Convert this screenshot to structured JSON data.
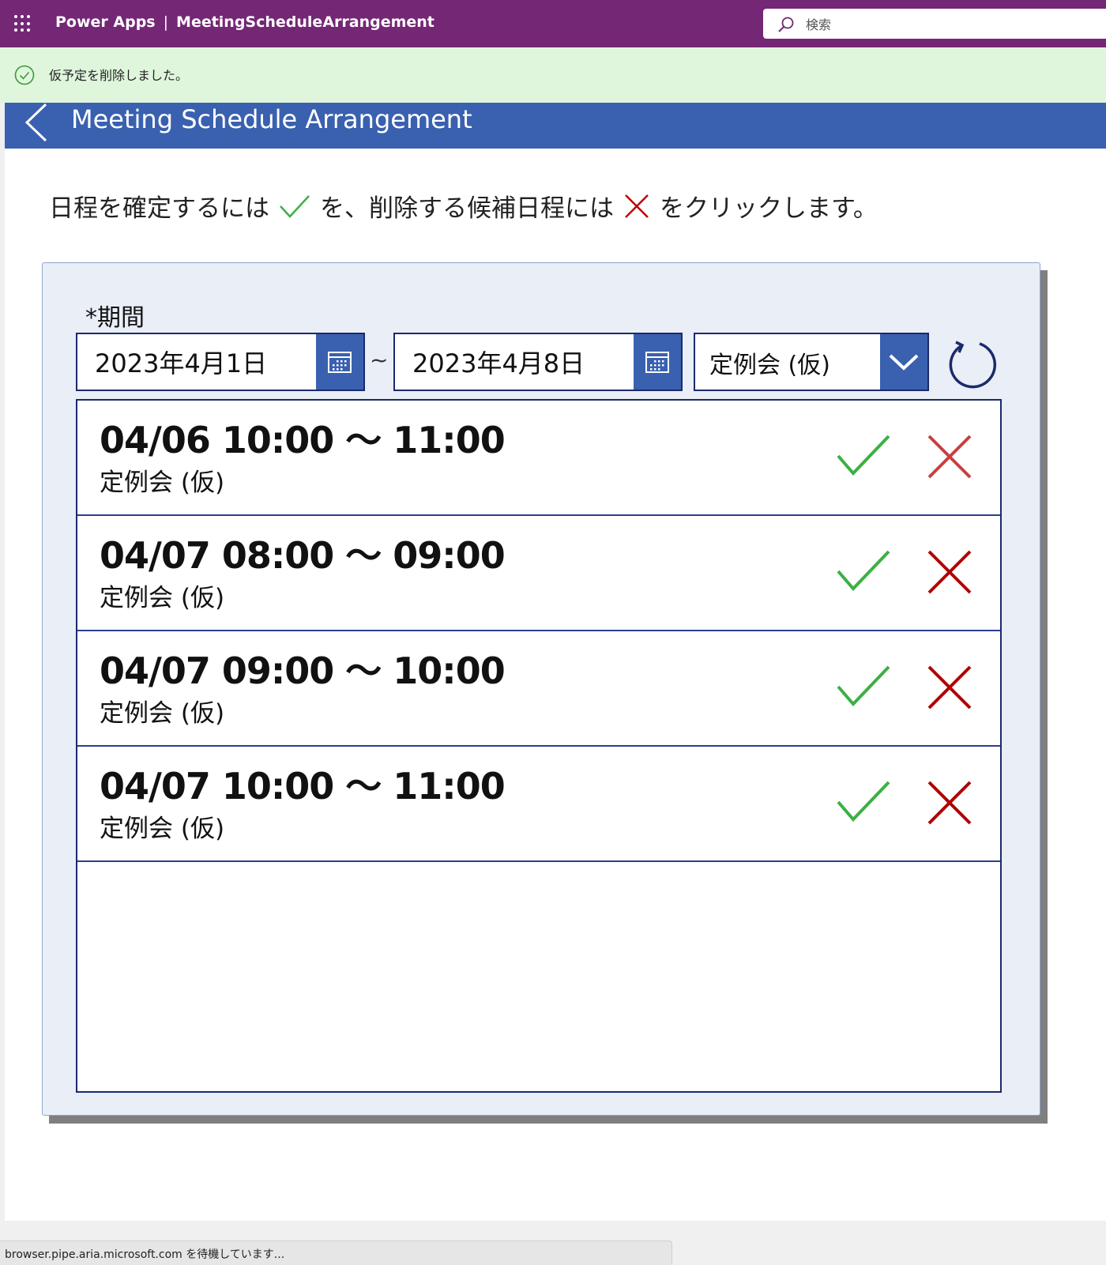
{
  "topbar": {
    "brand": "Power Apps",
    "separator": "|",
    "app_name": "MeetingScheduleArrangement",
    "search_placeholder": "検索",
    "background": "#742774"
  },
  "notification": {
    "message": "仮予定を削除しました。",
    "icon": "check-circle-icon",
    "background": "#dff6dd"
  },
  "header": {
    "title": "Meeting Schedule Arrangement",
    "back_icon": "chevron-left-icon",
    "background": "#3a60b0"
  },
  "instruction": {
    "part1": "日程を確定するには",
    "part2": "を、削除する候補日程には",
    "part3": "をクリックします。"
  },
  "filter": {
    "period_label": "*期間",
    "start_date": "2023年4月1日",
    "separator": "~",
    "end_date": "2023年4月8日",
    "category_selected": "定例会 (仮)"
  },
  "meetings": [
    {
      "time": "04/06 10:00 ～ 11:00",
      "title": "定例会 (仮)"
    },
    {
      "time": "04/07 08:00 ～ 09:00",
      "title": "定例会 (仮)"
    },
    {
      "time": "04/07 09:00 ～ 10:00",
      "title": "定例会 (仮)"
    },
    {
      "time": "04/07 10:00 ～ 11:00",
      "title": "定例会 (仮)"
    }
  ],
  "colors": {
    "confirm": "#3cb043",
    "delete": "#b00000",
    "delete_hover": "#c94040",
    "border": "#1b2a6b"
  },
  "statusbar": {
    "text": "browser.pipe.aria.microsoft.com を待機しています..."
  }
}
